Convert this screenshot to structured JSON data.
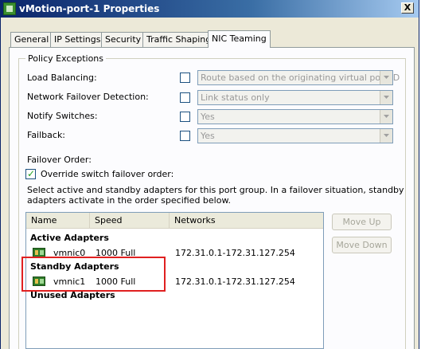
{
  "window": {
    "title": "vMotion-port-1 Properties",
    "close_glyph": "X"
  },
  "tabs": [
    {
      "label": "General",
      "active": false
    },
    {
      "label": "IP Settings",
      "active": false
    },
    {
      "label": "Security",
      "active": false
    },
    {
      "label": "Traffic Shaping",
      "active": false
    },
    {
      "label": "NIC Teaming",
      "active": true
    }
  ],
  "policy_exceptions": {
    "legend": "Policy Exceptions",
    "rows": [
      {
        "label": "Load Balancing:",
        "checked": false,
        "value": "Route based on the originating virtual port ID"
      },
      {
        "label": "Network Failover Detection:",
        "checked": false,
        "value": "Link status only"
      },
      {
        "label": "Notify Switches:",
        "checked": false,
        "value": "Yes"
      },
      {
        "label": "Failback:",
        "checked": false,
        "value": "Yes"
      }
    ],
    "failover_order_label": "Failover Order:",
    "override_label": "Override switch failover order:",
    "override_checked": true,
    "description_line1": "Select active and standby adapters for this port group.  In a failover situation, standby",
    "description_line2": "adapters activate  in the order specified below."
  },
  "adapters_list": {
    "columns": [
      "Name",
      "Speed",
      "Networks"
    ],
    "groups": {
      "active": "Active Adapters",
      "standby": "Standby Adapters",
      "unused": "Unused Adapters"
    },
    "active_rows": [
      {
        "name": "vmnic0",
        "speed": "1000 Full",
        "networks": "172.31.0.1-172.31.127.254"
      }
    ],
    "standby_rows": [
      {
        "name": "vmnic1",
        "speed": "1000 Full",
        "networks": "172.31.0.1-172.31.127.254"
      }
    ]
  },
  "buttons": {
    "move_up": "Move Up",
    "move_down": "Move Down"
  },
  "colors": {
    "highlight_border": "#e02020",
    "titlebar_start": "#0a246a",
    "panel_bg": "#fcfcfe"
  }
}
